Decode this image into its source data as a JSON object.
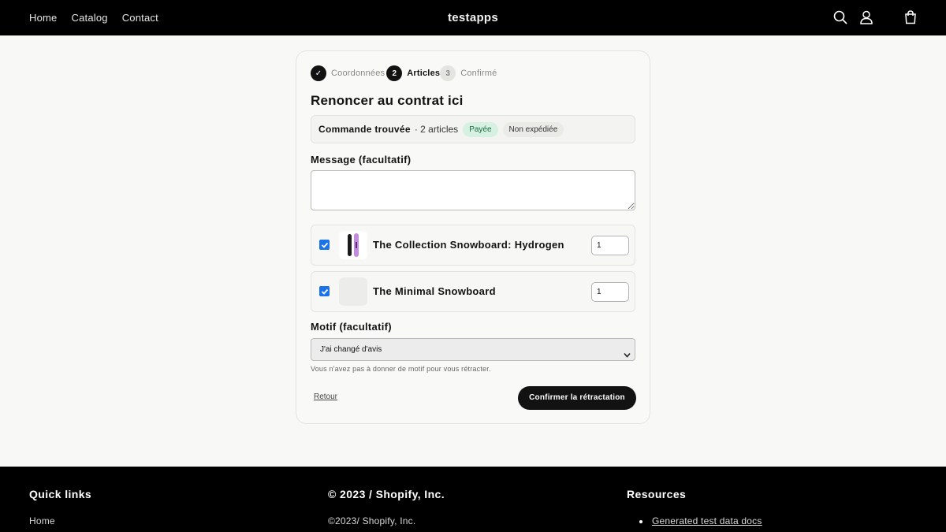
{
  "header": {
    "nav": [
      "Home",
      "Catalog",
      "Contact"
    ],
    "brand": "testapps",
    "icons": [
      "search-icon",
      "account-icon",
      "cart-icon"
    ]
  },
  "steps": [
    {
      "label": "Coordonnées",
      "marker": "✓",
      "state": "done"
    },
    {
      "label": "Articles",
      "marker": "2",
      "state": "active"
    },
    {
      "label": "Confirmé",
      "marker": "3",
      "state": "todo"
    }
  ],
  "form": {
    "title": "Renoncer au contrat ici",
    "order": {
      "found_label": "Commande trouvée",
      "count": "· 2 articles",
      "badges": [
        "Payée",
        "Non expédiée"
      ]
    },
    "message_label": "Message (facultatif)",
    "message_value": "",
    "items": [
      {
        "name": "The Collection Snowboard: Hydrogen",
        "qty": "1",
        "checked": true
      },
      {
        "name": "The Minimal Snowboard",
        "qty": "1",
        "checked": true
      }
    ],
    "reason_label": "Motif (facultatif)",
    "reason_selected": "J'ai changé d'avis",
    "reason_hint": "Vous n'avez pas à donner de motif pour vous rétracter.",
    "back_label": "Retour",
    "confirm_label": "Confirmer la rétractation"
  },
  "footer": {
    "quick_links_title": "Quick links",
    "quick_links": [
      "Home"
    ],
    "copyright_title": "© 2023 / Shopify, Inc.",
    "copyright_text": "©2023/ Shopify, Inc.",
    "resources_title": "Resources",
    "resources_links": [
      "Generated test data docs"
    ]
  },
  "colors": {
    "header_bg": "#000000",
    "checkbox": "#1a73e8",
    "paid_badge_bg": "#d6f1e1",
    "button_bg": "#121212"
  }
}
